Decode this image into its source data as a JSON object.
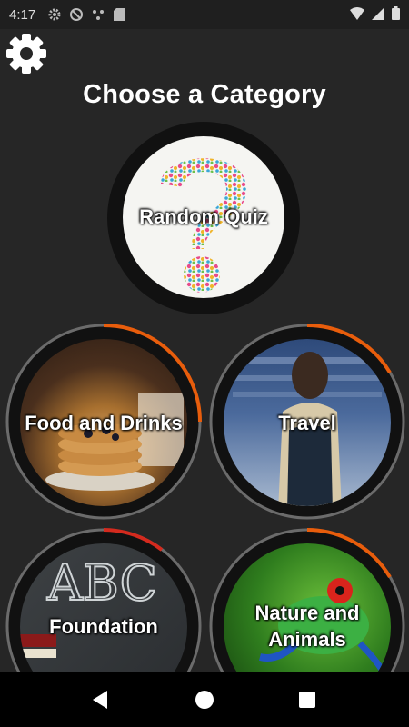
{
  "status_bar": {
    "time": "4:17"
  },
  "header": {
    "title": "Choose a Category",
    "settings_icon": "gear-icon"
  },
  "categories": [
    {
      "label": "Random Quiz",
      "image": "question-mark-illustration"
    },
    {
      "label": "Food and Drinks",
      "image": "pancakes-photo",
      "progress": 0.28
    },
    {
      "label": "Travel",
      "image": "airport-traveler-photo",
      "progress": 0.22
    },
    {
      "label_line1": "Foundation",
      "image": "chalkboard-photo",
      "progress": 0.12
    },
    {
      "label_line1": "Nature and",
      "label_line2": "Animals",
      "image": "tree-frog-photo",
      "progress": 0.22
    }
  ],
  "colors": {
    "background": "#262626",
    "progress_accent": "#e85d0c",
    "ring": "#6b6b6b"
  },
  "nav_bar": {
    "back_icon": "back-triangle-icon",
    "home_icon": "home-circle-icon",
    "recents_icon": "recents-square-icon"
  }
}
